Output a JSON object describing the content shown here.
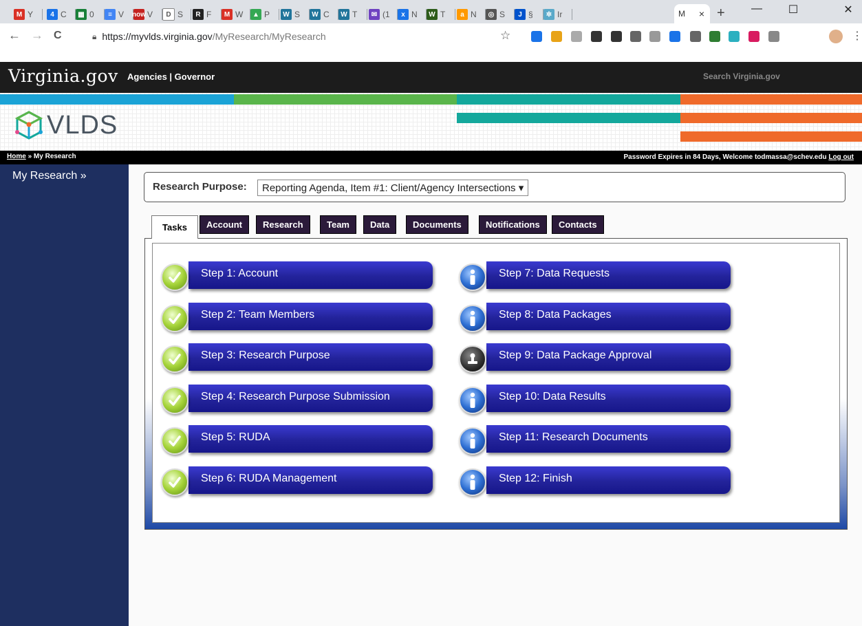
{
  "browser": {
    "tabs": [
      {
        "label": "M",
        "color": "#d93025",
        "text": "Y"
      },
      {
        "label": "4",
        "color": "#1a73e8",
        "text": "C"
      },
      {
        "label": "▦",
        "color": "#188038",
        "text": "0"
      },
      {
        "label": "≡",
        "color": "#4285f4",
        "text": "V"
      },
      {
        "label": "now",
        "color": "#c5221f",
        "text": "V"
      },
      {
        "label": "D",
        "color": "#ffffff",
        "text": "S"
      },
      {
        "label": "R",
        "color": "#222222",
        "text": "F"
      },
      {
        "label": "M",
        "color": "#d93025",
        "text": "W"
      },
      {
        "label": "▲",
        "color": "#34a853",
        "text": "P"
      },
      {
        "label": "W",
        "color": "#21759b",
        "text": "S"
      },
      {
        "label": "W",
        "color": "#21759b",
        "text": "C"
      },
      {
        "label": "W",
        "color": "#21759b",
        "text": "T"
      },
      {
        "label": "✉",
        "color": "#6f42c1",
        "text": "(1"
      },
      {
        "label": "x",
        "color": "#1a73e8",
        "text": "N"
      },
      {
        "label": "W",
        "color": "#2d5c1a",
        "text": "T"
      },
      {
        "label": "a",
        "color": "#f90",
        "text": "N"
      },
      {
        "label": "◎",
        "color": "#555555",
        "text": "S"
      },
      {
        "label": "J",
        "color": "#0052cc",
        "text": "§"
      },
      {
        "label": "✲",
        "color": "#5aa9c9",
        "text": "Ir"
      }
    ],
    "active_tab": {
      "text": "M",
      "close": "×"
    },
    "new_tab": "+",
    "window_controls": {
      "minimize": "—",
      "maximize": "☐",
      "close": "✕"
    },
    "nav": {
      "back": "←",
      "forward": "→",
      "reload": "C"
    },
    "url": {
      "host": "https://myvlds.virginia.gov",
      "path": "/MyResearch/MyResearch"
    },
    "star": "☆",
    "extension_colors": [
      "#1a73e8",
      "#e8a317",
      "#aaaaaa",
      "#333333",
      "#333333",
      "#666666",
      "#999999",
      "#1a73e8",
      "#666666",
      "#2e7d32",
      "#2bb0c0",
      "#d81b60",
      "#888888"
    ]
  },
  "va_header": {
    "logo": "Virginia.gov",
    "links": "Agencies | Governor",
    "search_placeholder": "Search Virginia.gov"
  },
  "banner": {
    "logo_text": "VLDS",
    "strip_colors": [
      "#1ba3d6",
      "#5ab54b",
      "#14a89c",
      "#ef6a2b"
    ]
  },
  "subbar": {
    "breadcrumb_home": "Home",
    "breadcrumb_sep": " » ",
    "breadcrumb_current": "My Research",
    "welcome": "Password Expires in 84 Days, Welcome todmassa@schev.edu",
    "logout": "Log out"
  },
  "sidebar": {
    "link": "My Research »"
  },
  "research_purpose": {
    "label": "Research Purpose:",
    "selected": "Reporting Agenda, Item #1: Client/Agency Intersections ▾"
  },
  "tabs": {
    "active": "Tasks",
    "items": [
      "Account",
      "Research",
      "Team",
      "Data",
      "Documents",
      "Notifications",
      "Contacts"
    ]
  },
  "steps": {
    "left": [
      {
        "label": "Step 1: Account",
        "icon": "check"
      },
      {
        "label": "Step 2: Team Members",
        "icon": "check"
      },
      {
        "label": "Step 3: Research Purpose",
        "icon": "check"
      },
      {
        "label": "Step 4: Research Purpose Submission",
        "icon": "check"
      },
      {
        "label": "Step 5: RUDA",
        "icon": "check"
      },
      {
        "label": "Step 6: RUDA Management",
        "icon": "check"
      }
    ],
    "right": [
      {
        "label": "Step 7: Data Requests",
        "icon": "info"
      },
      {
        "label": "Step 8: Data Packages",
        "icon": "info"
      },
      {
        "label": "Step 9: Data Package Approval",
        "icon": "stamp"
      },
      {
        "label": "Step 10: Data Results",
        "icon": "info"
      },
      {
        "label": "Step 11: Research Documents",
        "icon": "info"
      },
      {
        "label": "Step 12: Finish",
        "icon": "info"
      }
    ]
  }
}
